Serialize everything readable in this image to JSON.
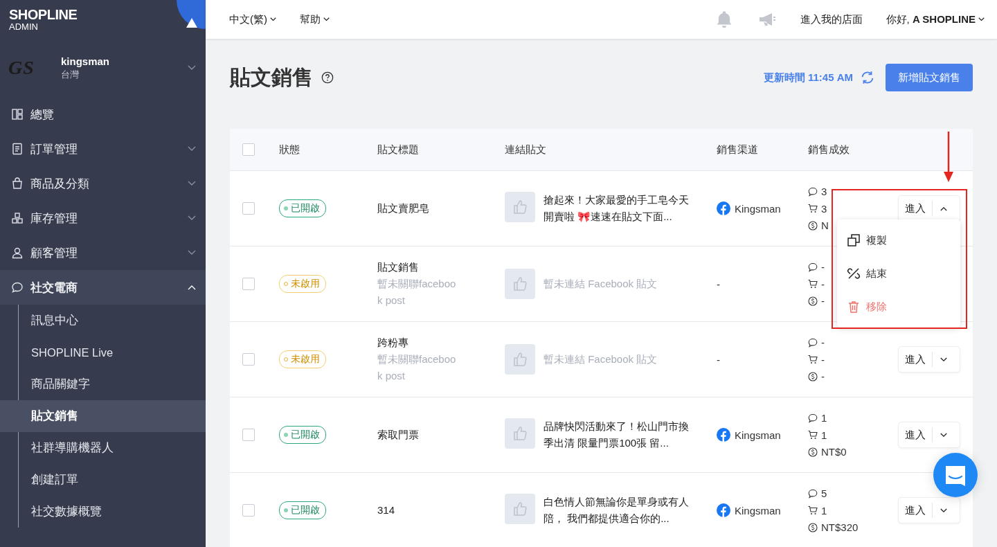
{
  "brand": {
    "name": "SHOPLINE",
    "sub": "ADMIN"
  },
  "store": {
    "logo": "GS",
    "name": "kingsman",
    "region": "台灣"
  },
  "sidebar": {
    "items": [
      {
        "label": "總覽",
        "expandable": false,
        "expanded": false
      },
      {
        "label": "訂單管理",
        "expandable": true,
        "expanded": false
      },
      {
        "label": "商品及分類",
        "expandable": true,
        "expanded": false
      },
      {
        "label": "庫存管理",
        "expandable": true,
        "expanded": false
      },
      {
        "label": "顧客管理",
        "expandable": true,
        "expanded": false
      },
      {
        "label": "社交電商",
        "expandable": true,
        "expanded": true,
        "children": [
          {
            "label": "訊息中心",
            "selected": false
          },
          {
            "label": "SHOPLINE Live",
            "selected": false
          },
          {
            "label": "商品關鍵字",
            "selected": false
          },
          {
            "label": "貼文銷售",
            "selected": true
          },
          {
            "label": "社群導購機器人",
            "selected": false
          },
          {
            "label": "創建訂單",
            "selected": false
          },
          {
            "label": "社交數據概覽",
            "selected": false
          }
        ]
      }
    ]
  },
  "topbar": {
    "language": "中文(繁)",
    "help": "幫助",
    "store_link": "進入我的店面",
    "greeting": "你好, **A SHOPLINE**"
  },
  "page": {
    "title": "貼文銷售",
    "updated": "更新時間 11:45 AM",
    "add_button": "新增貼文銷售"
  },
  "table": {
    "select_all": {
      "checked": false
    },
    "columns": [
      "狀態",
      "貼文標題",
      "連結貼文",
      "銷售渠道",
      "銷售成效"
    ],
    "rows": [
      {
        "checked": false,
        "status": {
          "kind": "active",
          "label": "已開啟"
        },
        "title": "貼文賣肥皂",
        "post": {
          "linked": true,
          "text": "搶起來！大家最愛的手工皂今天開賣啦 🎀速速在貼文下面..."
        },
        "channel": "Kingsman",
        "sales": [
          "3",
          "3",
          "N"
        ],
        "enter": "進入",
        "menu_open": true
      },
      {
        "checked": false,
        "status": {
          "kind": "inactive",
          "label": "未啟用"
        },
        "title": "貼文銷售",
        "subtitle": "暫未關聯facebook post",
        "post": {
          "linked": false,
          "text": "暫未連結 Facebook 貼文"
        },
        "channel": "-",
        "sales": [
          "-",
          "-",
          "-"
        ]
      },
      {
        "checked": false,
        "status": {
          "kind": "inactive",
          "label": "未啟用"
        },
        "title": "跨粉專",
        "subtitle": "暫未關聯facebook post",
        "post": {
          "linked": false,
          "text": "暫未連結 Facebook 貼文"
        },
        "channel": "-",
        "sales": [
          "-",
          "-",
          "-"
        ],
        "enter": "進入",
        "menu_open": false
      },
      {
        "checked": false,
        "status": {
          "kind": "active",
          "label": "已開啟"
        },
        "title": "索取門票",
        "post": {
          "linked": true,
          "text": "品牌快閃活動來了！松山門市換季出清 限量門票100張 留..."
        },
        "channel": "Kingsman",
        "sales": [
          "1",
          "1",
          "NT$0"
        ],
        "enter": "進入",
        "menu_open": false
      },
      {
        "checked": false,
        "status": {
          "kind": "active",
          "label": "已開啟"
        },
        "title": "314",
        "post": {
          "linked": true,
          "text": "白色情人節無論你是單身或有人陪， 我們都提供適合你的..."
        },
        "channel": "Kingsman",
        "sales": [
          "5",
          "1",
          "NT$320"
        ],
        "enter": "進入",
        "menu_open": false
      }
    ]
  },
  "menu": [
    {
      "kind": "copy",
      "label": "複製"
    },
    {
      "kind": "end",
      "label": "結束"
    },
    {
      "kind": "delete",
      "label": "移除"
    }
  ]
}
